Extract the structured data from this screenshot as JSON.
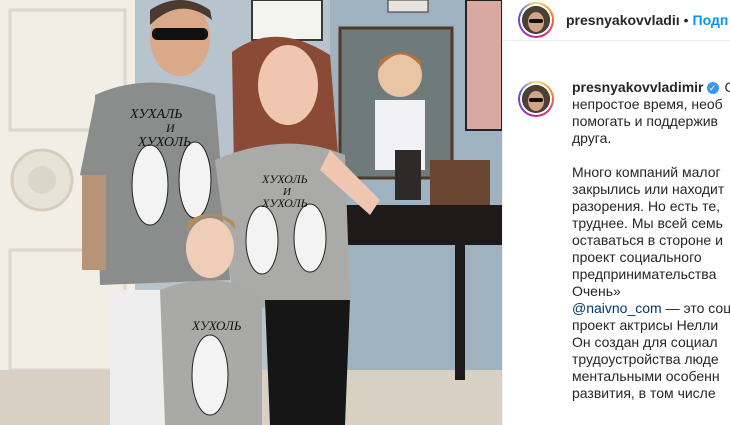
{
  "post": {
    "header": {
      "username": "presnyakovvladiı",
      "separator": "•",
      "follow_label": "Подп"
    },
    "caption": {
      "username": "presnyakovvladimir",
      "verified_mark": "✓",
      "trailing": "С",
      "lines": [
        "непростое время, необ",
        "помогать и поддержив",
        "друга."
      ],
      "lines2": [
        "Много компаний малог",
        "закрылись или находит",
        "разорения. Но есть те,",
        "труднее. Мы всей семь",
        "оставаться в стороне и",
        "проект социального",
        "предпринимательства",
        "Очень»"
      ],
      "mention": "@naivno_com",
      "mention_rest": " — это соц",
      "lines3": [
        "проект актрисы Нелли",
        "Он создан для социал",
        "трудоустройства люде",
        "ментальными особенн",
        "развития, в том числе"
      ]
    },
    "photo": {
      "shirt_text_man": [
        "ХУХАЛЬ",
        "И",
        "ХУХОЛЬ"
      ],
      "shirt_text_woman": [
        "ХУХОЛЬ",
        "И",
        "ХУХОЛЬ"
      ],
      "shirt_text_boy": [
        "ХУХОЛЬ"
      ]
    }
  },
  "icons": {
    "verified": "verified-badge-icon"
  },
  "colors": {
    "link": "#0095f6",
    "mention": "#00376b",
    "text": "#262626",
    "wall": "#b9c6cf"
  }
}
